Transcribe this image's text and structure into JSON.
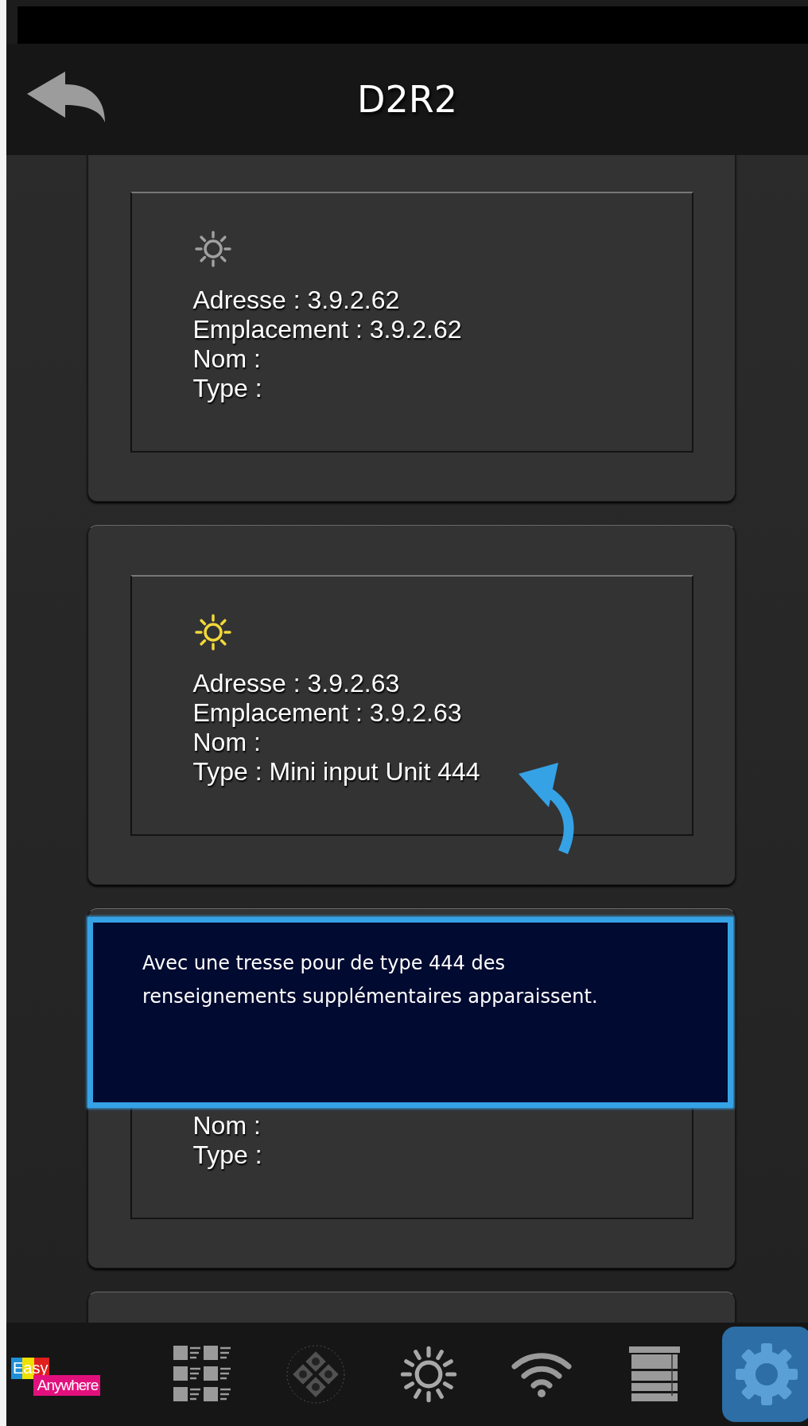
{
  "header": {
    "title": "D2R2"
  },
  "cards": [
    {
      "lit": false,
      "lines": [
        "Adresse : 3.9.2.62",
        "Emplacement : 3.9.2.62",
        "Nom :",
        "Type :"
      ]
    },
    {
      "lit": true,
      "lines": [
        "Adresse : 3.9.2.63",
        "Emplacement : 3.9.2.63",
        "Nom :",
        "Type : Mini input Unit 444"
      ]
    },
    {
      "lines": [
        "Nom :",
        "Type :"
      ]
    }
  ],
  "callout": {
    "text": "Avec une tresse pour de type 444 des renseignements supplémentaires apparaissent."
  },
  "nav": [
    {
      "kind": "logo",
      "word_1": "Easy",
      "word_2": "Anywhere",
      "selected": false,
      "disabled": false
    },
    {
      "kind": "grid",
      "selected": false,
      "disabled": false
    },
    {
      "kind": "dpad",
      "selected": false,
      "disabled": true
    },
    {
      "kind": "sun",
      "selected": false,
      "disabled": false
    },
    {
      "kind": "wifi",
      "selected": false,
      "disabled": false
    },
    {
      "kind": "blind",
      "selected": false,
      "disabled": false
    },
    {
      "kind": "gear",
      "selected": true,
      "disabled": false
    }
  ]
}
